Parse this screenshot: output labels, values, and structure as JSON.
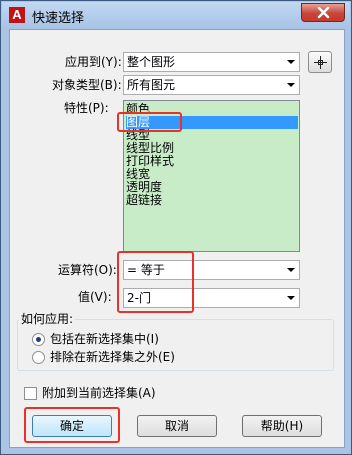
{
  "window": {
    "title": "快速选择",
    "app_icon_letter": "A",
    "close_label": "close"
  },
  "form": {
    "apply_to": {
      "label": "应用到(Y):",
      "value": "整个图形"
    },
    "object_type": {
      "label": "对象类型(B):",
      "value": "所有图元"
    },
    "properties": {
      "label": "特性(P):",
      "items": [
        "颜色",
        "图层",
        "线型",
        "线型比例",
        "打印样式",
        "线宽",
        "透明度",
        "超链接"
      ],
      "selected": "图层"
    },
    "operator": {
      "label": "运算符(O):",
      "value": "= 等于"
    },
    "value": {
      "label": "值(V):",
      "value": "2-门"
    }
  },
  "apply_group": {
    "title": "如何应用:",
    "include_label": "包括在新选择集中(I)",
    "exclude_label": "排除在新选择集之外(E)"
  },
  "append_label": "附加到当前选择集(A)",
  "buttons": {
    "ok": "确定",
    "cancel": "取消",
    "help": "帮助(H)"
  },
  "colors": {
    "title_bar": "#a9c4e4",
    "list_background": "#c8ecc8",
    "selection": "#3399ff",
    "highlight_box": "#e8312a"
  }
}
